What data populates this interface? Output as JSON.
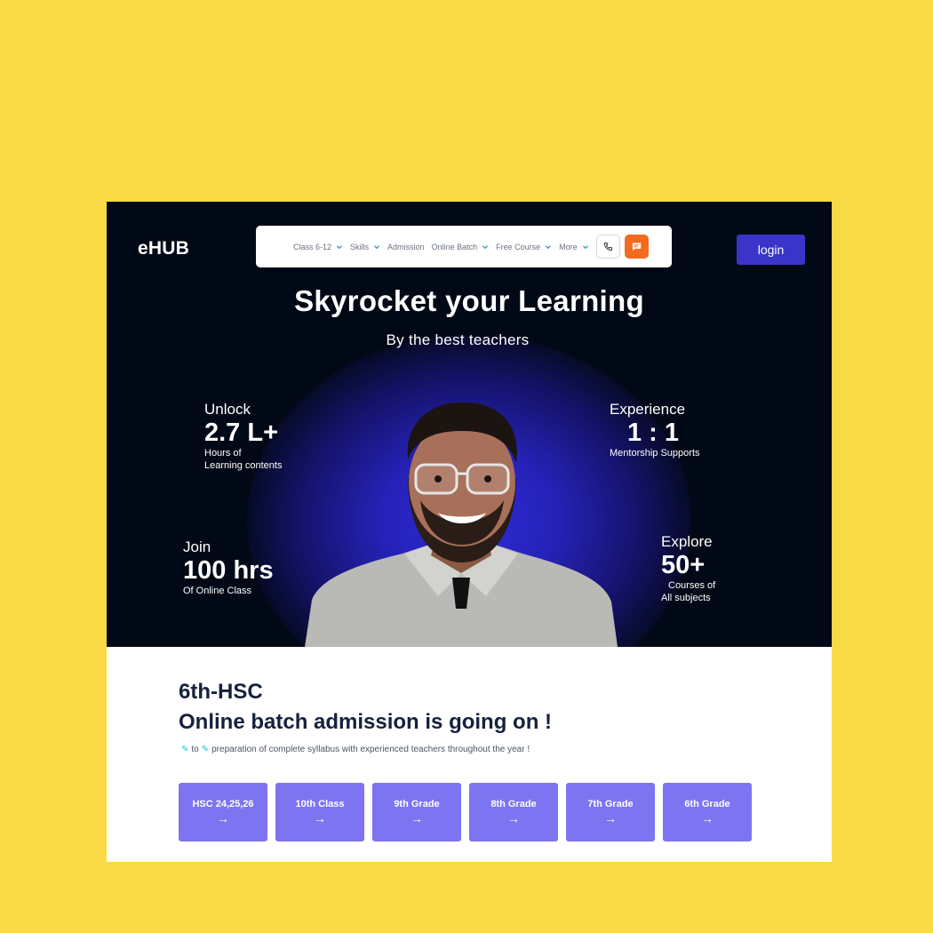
{
  "brand": {
    "logo": "eHUB"
  },
  "nav": {
    "items": [
      {
        "label": "Class 6-12",
        "dropdown": true
      },
      {
        "label": "Skills",
        "dropdown": true
      },
      {
        "label": "Admission",
        "dropdown": false
      },
      {
        "label": "Online Batch",
        "dropdown": true
      },
      {
        "label": "Free Course",
        "dropdown": true
      },
      {
        "label": "More",
        "dropdown": true
      }
    ],
    "phone_icon": "phone-icon",
    "chat_icon": "chat-icon",
    "login_label": "login"
  },
  "hero": {
    "headline": "Skyrocket your Learning",
    "subline": "By the best teachers",
    "stats": {
      "unlock": {
        "label": "Unlock",
        "value": "2.7 L+",
        "line1": "Hours of",
        "line2": "Learning contents"
      },
      "experience": {
        "label": "Experience",
        "value": "1 : 1",
        "line1": "Mentorship Supports"
      },
      "join": {
        "label": "Join",
        "value": "100 hrs",
        "line1": "Of Online Class"
      },
      "explore": {
        "label": "Explore",
        "value": "50+",
        "line1": "Courses of",
        "line2": "All  subjects"
      }
    }
  },
  "admission": {
    "kicker": "6th-HSC",
    "title": "Online batch admission is going on !",
    "desc_to": "to",
    "desc_text": "preparation of complete syllabus with experienced teachers throughout the year !",
    "grades": [
      "HSC 24,25,26",
      "10th Class",
      "9th Grade",
      "8th Grade",
      "7th Grade",
      "6th Grade"
    ],
    "arrow": "→"
  },
  "colors": {
    "page_bg": "#F8DB44",
    "hero_bg": "#020916",
    "accent": "#3A35C8",
    "chat_btn": "#F36B21",
    "grade_card": "#7C74F1"
  }
}
